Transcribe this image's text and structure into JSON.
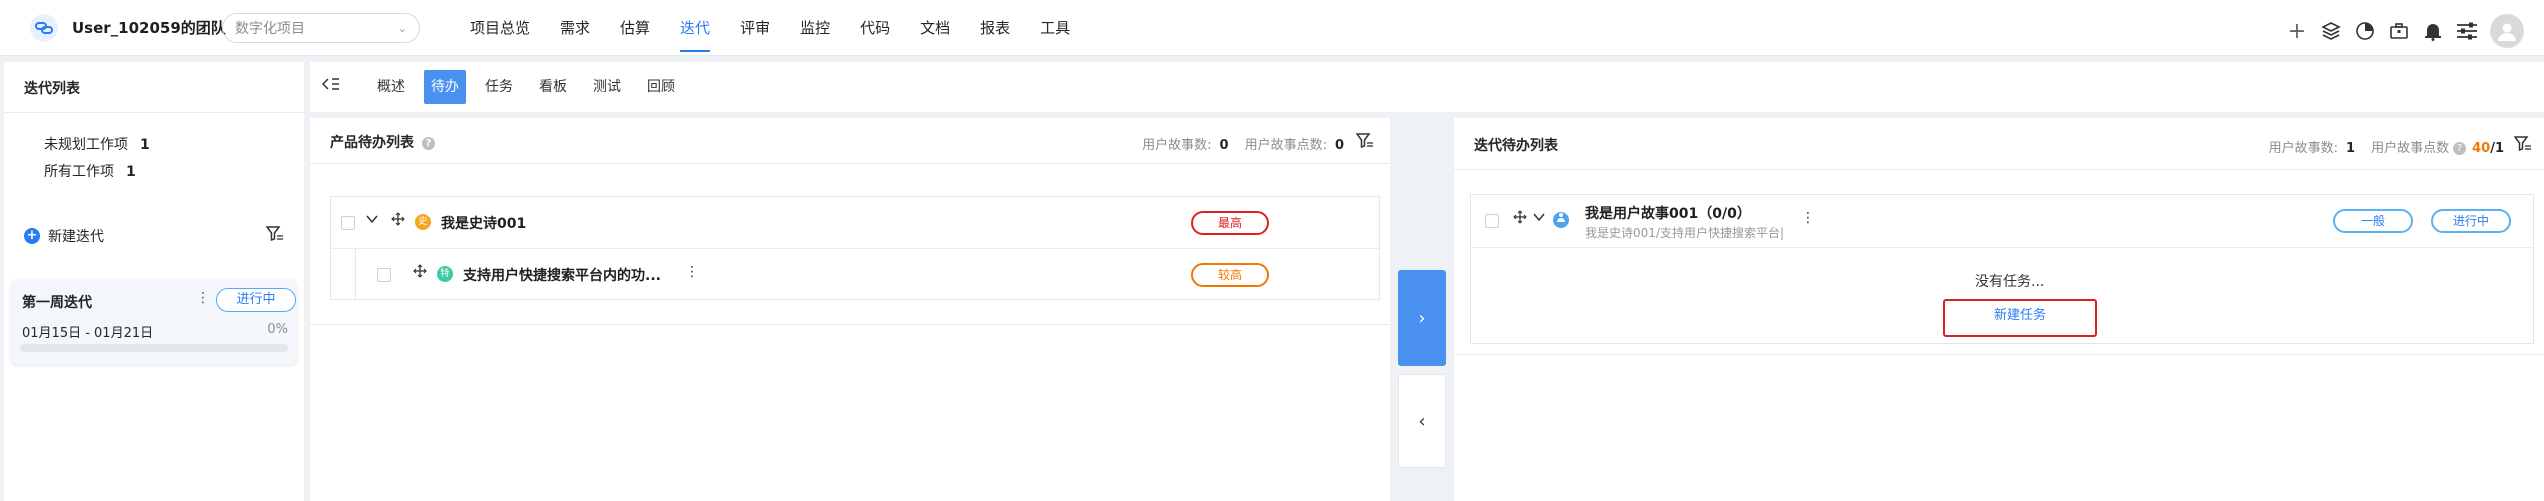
{
  "header": {
    "team": "User_102059的团队",
    "project": "数字化项目",
    "nav": [
      "项目总览",
      "需求",
      "估算",
      "迭代",
      "评审",
      "监控",
      "代码",
      "文档",
      "报表",
      "工具"
    ],
    "active_nav": "迭代"
  },
  "sidebar": {
    "title": "迭代列表",
    "unplanned_label": "未规划工作项",
    "unplanned_count": "1",
    "all_label": "所有工作项",
    "all_count": "1",
    "new_iteration": "新建迭代",
    "iteration": {
      "name": "第一周迭代",
      "status": "进行中",
      "dates": "01月15日 - 01月21日",
      "progress_text": "0%",
      "progress": 0
    }
  },
  "tabs": [
    "概述",
    "待办",
    "任务",
    "看板",
    "测试",
    "回顾"
  ],
  "active_tab": "待办",
  "product_backlog": {
    "title": "产品待办列表",
    "story_count_label": "用户故事数:",
    "story_count": "0",
    "story_points_label": "用户故事点数:",
    "story_points": "0",
    "epic": {
      "title": "我是史诗001",
      "priority": "最高"
    },
    "feature": {
      "title": "支持用户快捷搜索平台内的功...",
      "priority": "较高"
    }
  },
  "iteration_backlog": {
    "title": "迭代待办列表",
    "story_count_label": "用户故事数:",
    "story_count": "1",
    "story_points_label": "用户故事点数",
    "story_points_done": "40",
    "story_points_sep": "/1",
    "story": {
      "title": "我是用户故事001（0/0）",
      "path": "我是史诗001/支持用户快捷搜索平台|",
      "priority": "一般",
      "status": "进行中"
    },
    "empty_text": "没有任务...",
    "new_task": "新建任务"
  },
  "colors": {
    "accent": "#2a7bf6",
    "highest": "#e02020",
    "high": "#f07800",
    "epic_badge": "#f5a623",
    "feature_badge": "#3ec9a7",
    "story_badge": "#4aa3f0"
  }
}
